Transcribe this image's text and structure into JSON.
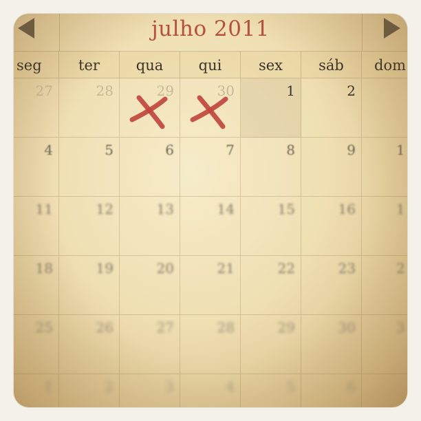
{
  "calendar": {
    "title": "julho 2011",
    "weekdays": [
      "seg",
      "ter",
      "qua",
      "qui",
      "sex",
      "sáb",
      "dom"
    ],
    "weeks": [
      [
        "27",
        "28",
        "29",
        "30",
        "1",
        "2",
        ""
      ],
      [
        "4",
        "5",
        "6",
        "7",
        "8",
        "9",
        "1"
      ],
      [
        "11",
        "12",
        "13",
        "14",
        "15",
        "16",
        "1"
      ],
      [
        "18",
        "19",
        "20",
        "21",
        "22",
        "23",
        "2"
      ],
      [
        "25",
        "26",
        "27",
        "28",
        "29",
        "30",
        "3"
      ],
      [
        "1",
        "2",
        "3",
        "4",
        "5",
        "6",
        ""
      ]
    ],
    "marked_days": [
      "29",
      "30"
    ],
    "colors": {
      "title": "#b5503b",
      "x_mark": "#c0483e",
      "arrows": "#6b5e47"
    }
  }
}
